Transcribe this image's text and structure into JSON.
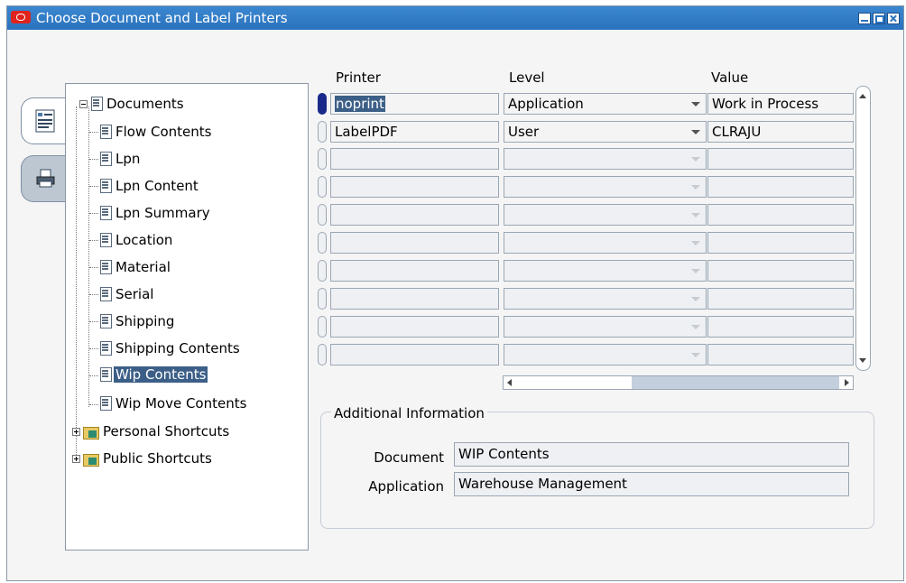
{
  "window": {
    "title": "Choose Document and Label Printers"
  },
  "tabs": [
    {
      "icon": "document-list-icon"
    },
    {
      "icon": "printer-icon"
    }
  ],
  "tree": {
    "root": "Documents",
    "children": [
      "Flow Contents",
      "Lpn",
      "Lpn Content",
      "Lpn Summary",
      "Location",
      "Material",
      "Serial",
      "Shipping",
      "Shipping Contents",
      "Wip Contents",
      "Wip Move Contents"
    ],
    "selected": "Wip Contents",
    "folders": [
      "Personal Shortcuts",
      "Public Shortcuts"
    ]
  },
  "grid": {
    "headers": {
      "printer": "Printer",
      "level": "Level",
      "value": "Value"
    },
    "rows": [
      {
        "printer": "noprint",
        "level": "Application",
        "value": "Work in Process"
      },
      {
        "printer": "LabelPDF",
        "level": "User",
        "value": "CLRAJU"
      }
    ]
  },
  "additional": {
    "legend": "Additional Information",
    "document_label": "Document",
    "document_value": "WIP Contents",
    "application_label": "Application",
    "application_value": "Warehouse Management"
  }
}
